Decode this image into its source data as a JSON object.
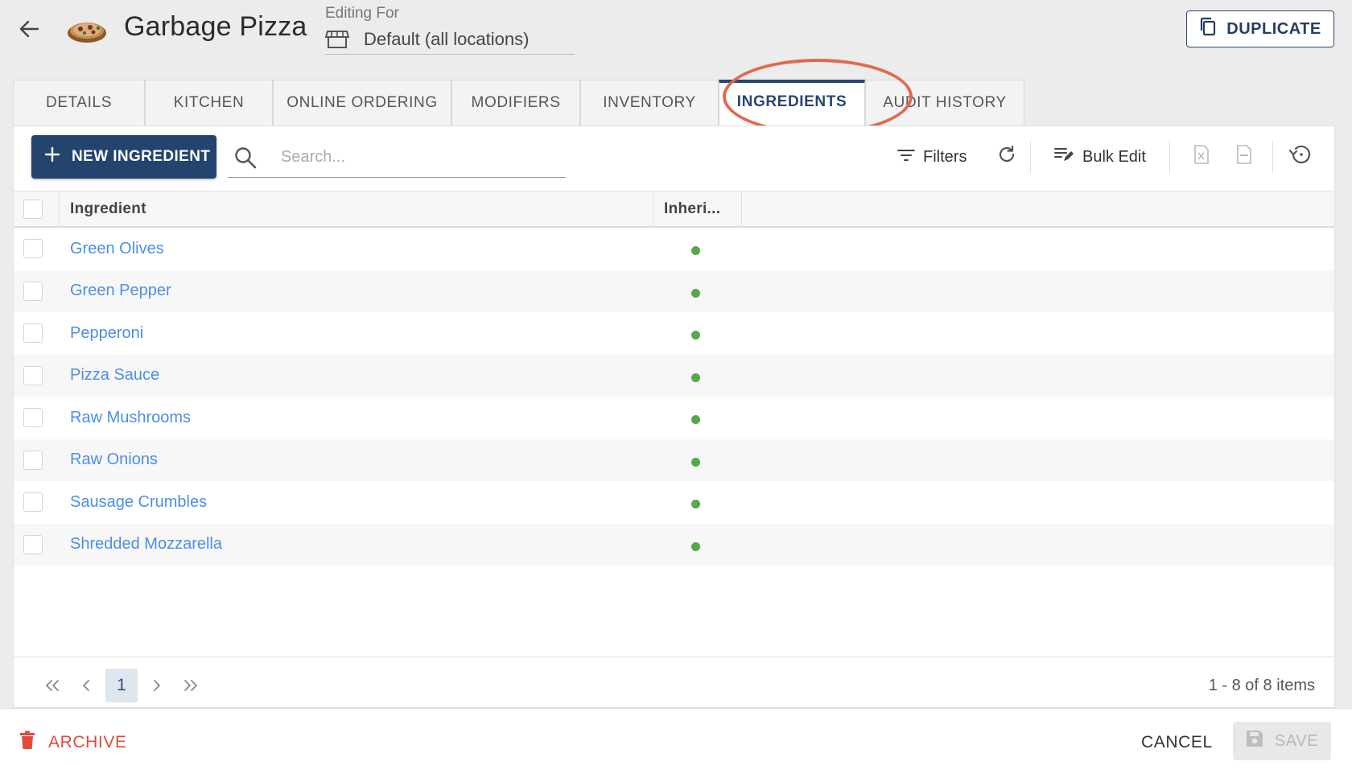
{
  "header": {
    "title": "Garbage Pizza",
    "editing_for_label": "Editing For",
    "location": "Default (all locations)",
    "duplicate_label": "DUPLICATE"
  },
  "tabs": [
    {
      "label": "DETAILS",
      "active": false
    },
    {
      "label": "KITCHEN",
      "active": false
    },
    {
      "label": "ONLINE ORDERING",
      "active": false
    },
    {
      "label": "MODIFIERS",
      "active": false
    },
    {
      "label": "INVENTORY",
      "active": false
    },
    {
      "label": "INGREDIENTS",
      "active": true
    },
    {
      "label": "AUDIT HISTORY",
      "active": false
    }
  ],
  "toolbar": {
    "new_label": "NEW INGREDIENT",
    "search_placeholder": "Search...",
    "filters_label": "Filters",
    "bulk_edit_label": "Bulk Edit"
  },
  "grid": {
    "columns": [
      "Ingredient",
      "Inheri..."
    ],
    "rows": [
      {
        "name": "Green Olives",
        "inherited": true
      },
      {
        "name": "Green Pepper",
        "inherited": true
      },
      {
        "name": "Pepperoni",
        "inherited": true
      },
      {
        "name": "Pizza Sauce",
        "inherited": true
      },
      {
        "name": "Raw Mushrooms",
        "inherited": true
      },
      {
        "name": "Raw Onions",
        "inherited": true
      },
      {
        "name": "Sausage Crumbles",
        "inherited": true
      },
      {
        "name": "Shredded Mozzarella",
        "inherited": true
      }
    ]
  },
  "pager": {
    "current_page": "1",
    "info": "1 - 8 of 8 items"
  },
  "footer": {
    "archive_label": "ARCHIVE",
    "cancel_label": "CANCEL",
    "save_label": "SAVE"
  },
  "colors": {
    "primary": "#23446d",
    "link": "#4d8ee6",
    "status_dot": "#55a84c",
    "archive": "#e14b3b",
    "highlight_ring": "#e2684f"
  }
}
